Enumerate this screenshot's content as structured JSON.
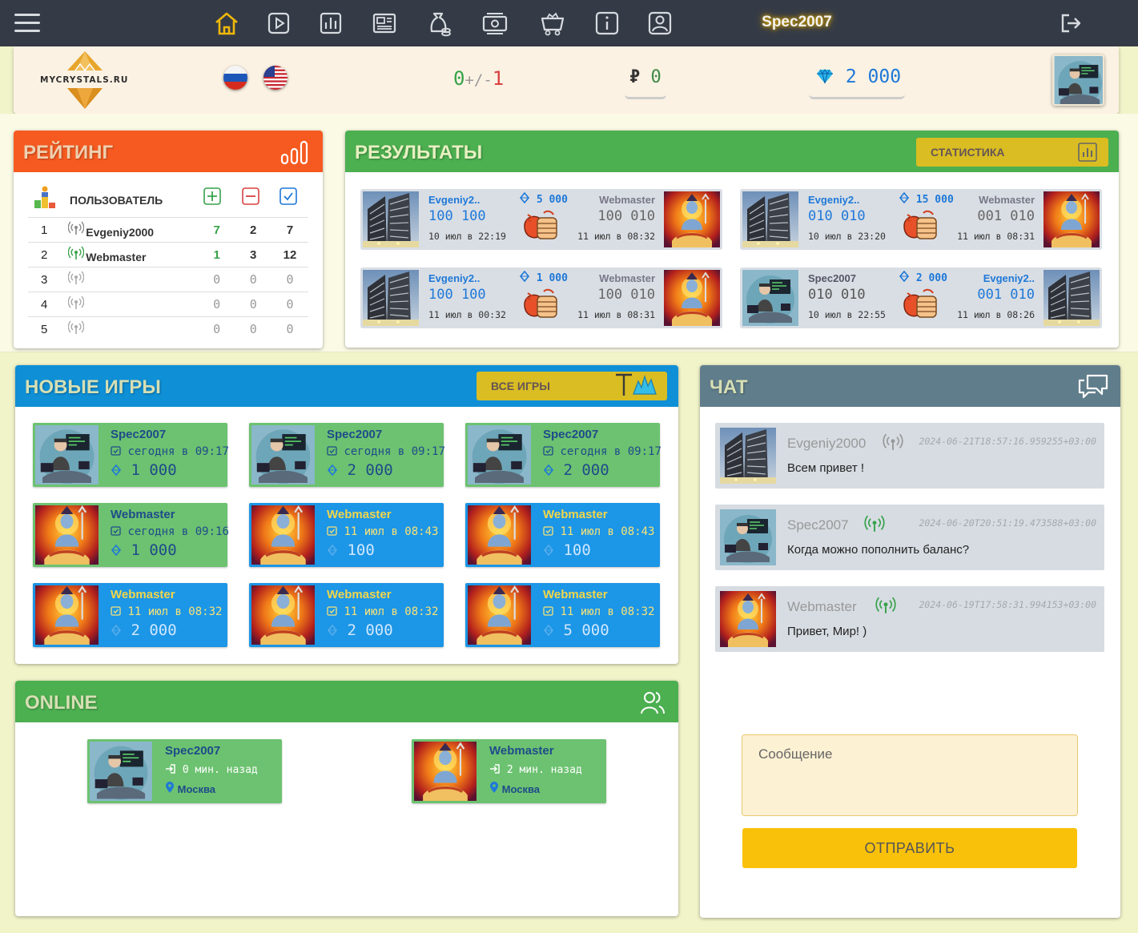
{
  "topbar": {
    "username": "Spec2007"
  },
  "header": {
    "brand": "MYCRYSTALS.RU",
    "score_wins": "0",
    "score_sep": "+/-",
    "score_losses": "1",
    "rub_symbol": "₽",
    "rub_value": "0",
    "crystals": "2 000"
  },
  "rating": {
    "title": "РЕЙТИНГ",
    "col_user": "ПОЛЬЗОВАТЕЛЬ",
    "rows": [
      {
        "n": "1",
        "user": "Evgeniy2000",
        "w": "7",
        "l": "2",
        "d": "7"
      },
      {
        "n": "2",
        "user": "Webmaster",
        "w": "1",
        "l": "3",
        "d": "12"
      },
      {
        "n": "3",
        "user": "",
        "w": "0",
        "l": "0",
        "d": "0"
      },
      {
        "n": "4",
        "user": "",
        "w": "0",
        "l": "0",
        "d": "0"
      },
      {
        "n": "5",
        "user": "",
        "w": "0",
        "l": "0",
        "d": "0"
      }
    ]
  },
  "results": {
    "title": "РЕЗУЛЬТАТЫ",
    "stats_button": "СТАТИСТИКА",
    "cards": [
      {
        "a": "Evgeniy2..",
        "b": "Webmaster",
        "stake": "5 000",
        "sa": "100 100",
        "sb": "100 010",
        "da": "10 июл в 22:19",
        "db": "11 июл в 08:32",
        "av_a": "building",
        "av_b": "shiva"
      },
      {
        "a": "Evgeniy2..",
        "b": "Webmaster",
        "stake": "15 000",
        "sa": "010 010",
        "sb": "001 010",
        "da": "10 июл в 23:20",
        "db": "11 июл в 08:31",
        "av_a": "building",
        "av_b": "shiva"
      },
      {
        "a": "Evgeniy2..",
        "b": "Webmaster",
        "stake": "1 000",
        "sa": "100 100",
        "sb": "100 010",
        "da": "11 июл в 00:32",
        "db": "11 июл в 08:31",
        "av_a": "building",
        "av_b": "shiva"
      },
      {
        "a": "Spec2007",
        "b": "Evgeniy2..",
        "stake": "2 000",
        "sa": "010 010",
        "sb": "001 010",
        "da": "10 июл в 22:55",
        "db": "11 июл в 08:26",
        "av_a": "coder",
        "av_b": "building"
      }
    ]
  },
  "new_games": {
    "title": "НОВЫЕ ИГРЫ",
    "all_games_button": "ВСЕ ИГРЫ",
    "cards": [
      {
        "name": "Spec2007",
        "date": "сегодня в 09:17",
        "amount": "1 000",
        "color": "g",
        "av": "coder"
      },
      {
        "name": "Spec2007",
        "date": "сегодня в 09:17",
        "amount": "2 000",
        "color": "g",
        "av": "coder"
      },
      {
        "name": "Spec2007",
        "date": "сегодня в 09:17",
        "amount": "2 000",
        "color": "g",
        "av": "coder"
      },
      {
        "name": "Webmaster",
        "date": "сегодня в 09:16",
        "amount": "1 000",
        "color": "g",
        "av": "shiva"
      },
      {
        "name": "Webmaster",
        "date": "11 июл в 08:43",
        "amount": "100",
        "color": "b",
        "av": "shiva"
      },
      {
        "name": "Webmaster",
        "date": "11 июл в 08:43",
        "amount": "100",
        "color": "b",
        "av": "shiva"
      },
      {
        "name": "Webmaster",
        "date": "11 июл в 08:32",
        "amount": "2 000",
        "color": "b",
        "av": "shiva"
      },
      {
        "name": "Webmaster",
        "date": "11 июл в 08:32",
        "amount": "2 000",
        "color": "b",
        "av": "shiva"
      },
      {
        "name": "Webmaster",
        "date": "11 июл в 08:32",
        "amount": "5 000",
        "color": "b",
        "av": "shiva"
      }
    ]
  },
  "online": {
    "title": "ONLINE",
    "users": [
      {
        "name": "Spec2007",
        "last": "0 мин. назад",
        "city": "Москва",
        "av": "coder"
      },
      {
        "name": "Webmaster",
        "last": "2 мин. назад",
        "city": "Москва",
        "av": "shiva"
      }
    ]
  },
  "chat": {
    "title": "ЧАТ",
    "messages": [
      {
        "user": "Evgeniy2000",
        "time": "2024-06-21T18:57:16.959255+03:00",
        "text": "Всем привет !",
        "av": "building"
      },
      {
        "user": "Spec2007",
        "time": "2024-06-20T20:51:19.473588+03:00",
        "text": "Когда можно пополнить баланс?",
        "av": "coder"
      },
      {
        "user": "Webmaster",
        "time": "2024-06-19T17:58:31.994153+03:00",
        "text": "Привет, Мир! )",
        "av": "shiva"
      }
    ],
    "placeholder": "Сообщение",
    "send_button": "ОТПРАВИТЬ"
  },
  "colors": {
    "rating": "#f65a20",
    "results": "#4caf50",
    "new_games": "#0f8fd6",
    "chat": "#607d8b",
    "online": "#4caf50"
  }
}
